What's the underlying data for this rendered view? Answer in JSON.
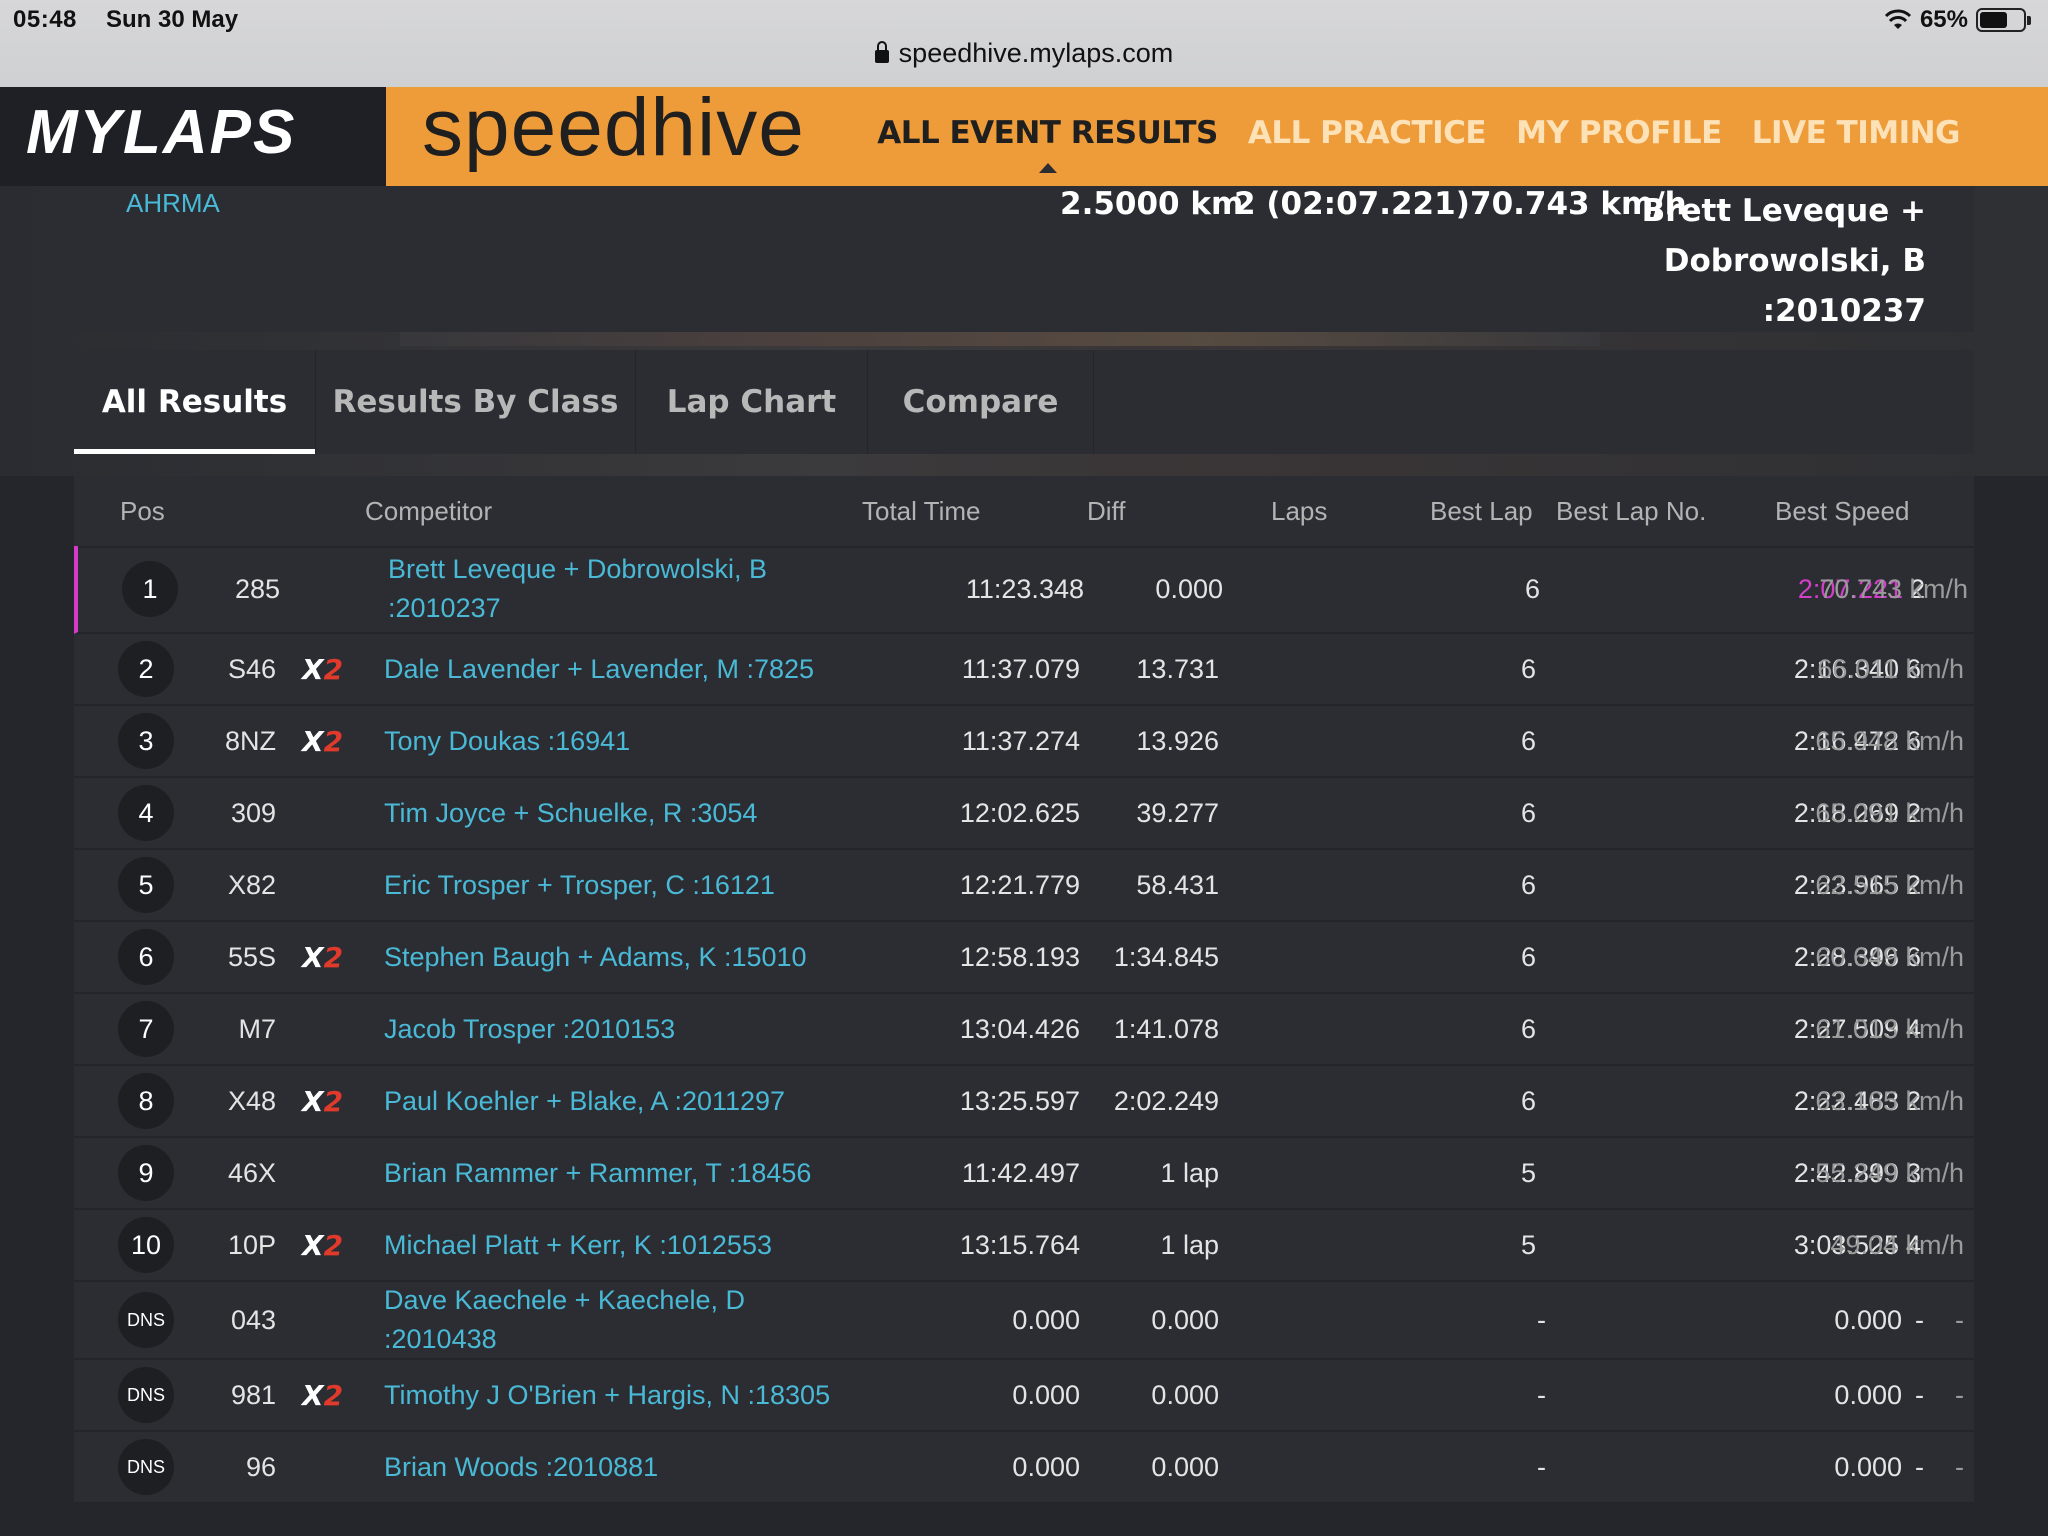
{
  "status_bar": {
    "time": "05:48",
    "date": "Sun 30 May",
    "battery": "65%",
    "battery_level": 0.65
  },
  "url": "speedhive.mylaps.com",
  "header": {
    "logo": "MYLAPS",
    "brand": "speedhive",
    "nav": [
      "ALL EVENT RESULTS",
      "ALL PRACTICE",
      "MY PROFILE",
      "LIVE TIMING"
    ]
  },
  "event": {
    "organization": "AHRMA",
    "distance": "2.5000 km",
    "best_lap": "2 (02:07.221)",
    "best_speed": "70.743 km/h",
    "winner_lines": [
      "Brett Leveque +",
      "Dobrowolski, B",
      ":2010237"
    ]
  },
  "tabs": [
    "All Results",
    "Results By Class",
    "Lap Chart",
    "Compare"
  ],
  "table": {
    "columns": [
      "Pos",
      "Competitor",
      "Total Time",
      "Diff",
      "Laps",
      "Best Lap",
      "Best Lap No.",
      "Best Speed"
    ],
    "x2_label": {
      "x": "X",
      "n": "2"
    },
    "rows": [
      {
        "pos": "1",
        "num": "285",
        "x2": false,
        "comp": [
          "Brett Leveque + Dobrowolski, B",
          ":2010237"
        ],
        "total": "11:23.348",
        "diff": "0.000",
        "laps": "6",
        "best": "2:07.221",
        "bestno": "2",
        "speed": "70.743 km/h"
      },
      {
        "pos": "2",
        "num": "S46",
        "x2": true,
        "comp": [
          "Dale Lavender + Lavender, M :7825"
        ],
        "total": "11:37.079",
        "diff": "13.731",
        "laps": "6",
        "best": "2:16.340",
        "bestno": "6",
        "speed": "66.011 km/h"
      },
      {
        "pos": "3",
        "num": "8NZ",
        "x2": true,
        "comp": [
          "Tony Doukas :16941"
        ],
        "total": "11:37.274",
        "diff": "13.926",
        "laps": "6",
        "best": "2:16.472",
        "bestno": "6",
        "speed": "65.948 km/h"
      },
      {
        "pos": "4",
        "num": "309",
        "x2": false,
        "comp": [
          "Tim Joyce + Schuelke, R :3054"
        ],
        "total": "12:02.625",
        "diff": "39.277",
        "laps": "6",
        "best": "2:18.269",
        "bestno": "2",
        "speed": "65.091 km/h"
      },
      {
        "pos": "5",
        "num": "X82",
        "x2": false,
        "comp": [
          "Eric Trosper + Trosper, C :16121"
        ],
        "total": "12:21.779",
        "diff": "58.431",
        "laps": "6",
        "best": "2:23.965",
        "bestno": "2",
        "speed": "62.515 km/h"
      },
      {
        "pos": "6",
        "num": "55S",
        "x2": true,
        "comp": [
          "Stephen Baugh + Adams, K :15010"
        ],
        "total": "12:58.193",
        "diff": "1:34.845",
        "laps": "6",
        "best": "2:28.396",
        "bestno": "6",
        "speed": "60.649 km/h"
      },
      {
        "pos": "7",
        "num": "M7",
        "x2": false,
        "comp": [
          "Jacob Trosper :2010153"
        ],
        "total": "13:04.426",
        "diff": "1:41.078",
        "laps": "6",
        "best": "2:27.509",
        "bestno": "4",
        "speed": "61.013 km/h"
      },
      {
        "pos": "8",
        "num": "X48",
        "x2": true,
        "comp": [
          "Paul Koehler + Blake, A :2011297"
        ],
        "total": "13:25.597",
        "diff": "2:02.249",
        "laps": "6",
        "best": "2:22.483",
        "bestno": "2",
        "speed": "63.165 km/h"
      },
      {
        "pos": "9",
        "num": "46X",
        "x2": false,
        "comp": [
          "Brian Rammer + Rammer, T :18456"
        ],
        "total": "11:42.497",
        "diff": "1 lap",
        "laps": "5",
        "best": "2:42.899",
        "bestno": "3",
        "speed": "55.249 km/h"
      },
      {
        "pos": "10",
        "num": "10P",
        "x2": true,
        "comp": [
          "Michael Platt + Kerr, K :1012553"
        ],
        "total": "13:15.764",
        "diff": "1 lap",
        "laps": "5",
        "best": "3:03.525",
        "bestno": "4",
        "speed": "49.04 km/h"
      },
      {
        "pos": "DNS",
        "num": "043",
        "x2": false,
        "comp": [
          "Dave Kaechele + Kaechele, D",
          ":2010438"
        ],
        "total": "0.000",
        "diff": "0.000",
        "laps": "-",
        "best": "0.000",
        "bestno": "-",
        "speed": "-"
      },
      {
        "pos": "DNS",
        "num": "981",
        "x2": true,
        "comp": [
          "Timothy J O'Brien + Hargis, N :18305"
        ],
        "total": "0.000",
        "diff": "0.000",
        "laps": "-",
        "best": "0.000",
        "bestno": "-",
        "speed": "-"
      },
      {
        "pos": "DNS",
        "num": "96",
        "x2": false,
        "comp": [
          "Brian Woods :2010881"
        ],
        "total": "0.000",
        "diff": "0.000",
        "laps": "-",
        "best": "0.000",
        "bestno": "-",
        "speed": "-"
      }
    ]
  },
  "colors": {
    "accent": "#ee9b3a",
    "link": "#49b9d6",
    "best_overall": "#d23fc8",
    "x2_red": "#e03a2b"
  }
}
